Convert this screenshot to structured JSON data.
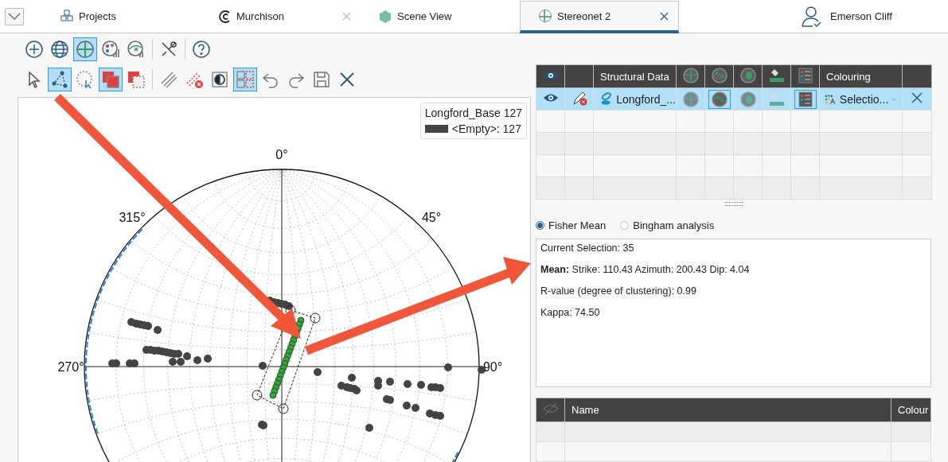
{
  "tabs": [
    {
      "label": "Projects",
      "kind": "cubes",
      "closable": false,
      "selected": false
    },
    {
      "label": "Murchison",
      "kind": "logo",
      "closable": true,
      "selected": false
    },
    {
      "label": "Scene View",
      "kind": "hexagon",
      "closable": false,
      "selected": false
    },
    {
      "label": "Stereonet 2",
      "kind": "stereonet",
      "closable": true,
      "selected": true
    }
  ],
  "user": {
    "name": "Emerson Cliff"
  },
  "toolbars": [
    {
      "buttons": [
        {
          "kind": "add",
          "selected": false
        },
        {
          "kind": "globe",
          "selected": false
        },
        {
          "kind": "stereonet",
          "selected": true
        },
        {
          "kind": "palette",
          "selected": false
        },
        {
          "kind": "chart-x",
          "selected": false
        },
        {
          "kind": "separator"
        },
        {
          "kind": "tools",
          "selected": false
        },
        {
          "kind": "separator"
        },
        {
          "kind": "help",
          "selected": false
        }
      ]
    },
    {
      "buttons": [
        {
          "kind": "pointer",
          "selected": false
        },
        {
          "kind": "polygon",
          "selected": true
        },
        {
          "kind": "lasso",
          "selected": false
        },
        {
          "kind": "square",
          "selected": true
        },
        {
          "kind": "square-dashed",
          "selected": false
        },
        {
          "kind": "separator"
        },
        {
          "kind": "lines",
          "selected": false
        },
        {
          "kind": "lines-x",
          "selected": false
        },
        {
          "kind": "contrast",
          "selected": false
        },
        {
          "kind": "grid",
          "selected": true
        },
        {
          "kind": "undo",
          "selected": false
        },
        {
          "kind": "redo",
          "selected": false
        },
        {
          "kind": "save",
          "selected": false
        },
        {
          "kind": "close",
          "selected": false
        }
      ]
    }
  ],
  "stereonet": {
    "legend": {
      "title": "Longford_Base 127",
      "entry": "<Empty>: 127"
    },
    "angle_labels": [
      {
        "text": "0°",
        "kind": "n"
      },
      {
        "text": "315°",
        "kind": "nw"
      },
      {
        "text": "45°",
        "kind": "ne"
      },
      {
        "text": "270°",
        "kind": "w"
      },
      {
        "text": "90°",
        "kind": "e"
      }
    ]
  },
  "data_table": {
    "columns": [
      {
        "kind": "eye"
      },
      {
        "kind": "blank"
      },
      {
        "kind": "text",
        "label": "Structural Data"
      },
      {
        "kind": "planes"
      },
      {
        "kind": "poles"
      },
      {
        "kind": "contours"
      },
      {
        "kind": "fill"
      },
      {
        "kind": "legend"
      },
      {
        "kind": "text",
        "label": "Colouring"
      },
      {
        "kind": "blank"
      }
    ],
    "rows": [
      {
        "visible": true,
        "selected": true,
        "name": "Longford_...",
        "toggles": [
          {
            "kind": "planes",
            "on": false
          },
          {
            "kind": "poles",
            "on": true
          },
          {
            "kind": "contours",
            "on": false
          },
          {
            "kind": "fill",
            "on": false
          },
          {
            "kind": "legend",
            "on": true
          }
        ],
        "colouring": "Selectio..."
      }
    ]
  },
  "analysis": {
    "options": [
      {
        "label": "Fisher Mean",
        "selected": true
      },
      {
        "label": "Bingham analysis",
        "selected": false
      }
    ],
    "lines": [
      "Current Selection: 35",
      "**Mean:** Strike: 110.43 Azimuth: 200.43 Dip: 4.04",
      "R-value (degree of clustering): 0.99",
      "Kappa: 74.50"
    ]
  },
  "sets_table": {
    "columns": [
      {
        "kind": "eye-off"
      },
      {
        "kind": "text",
        "label": "Name"
      },
      {
        "kind": "text",
        "label": "Colour"
      }
    ]
  }
}
